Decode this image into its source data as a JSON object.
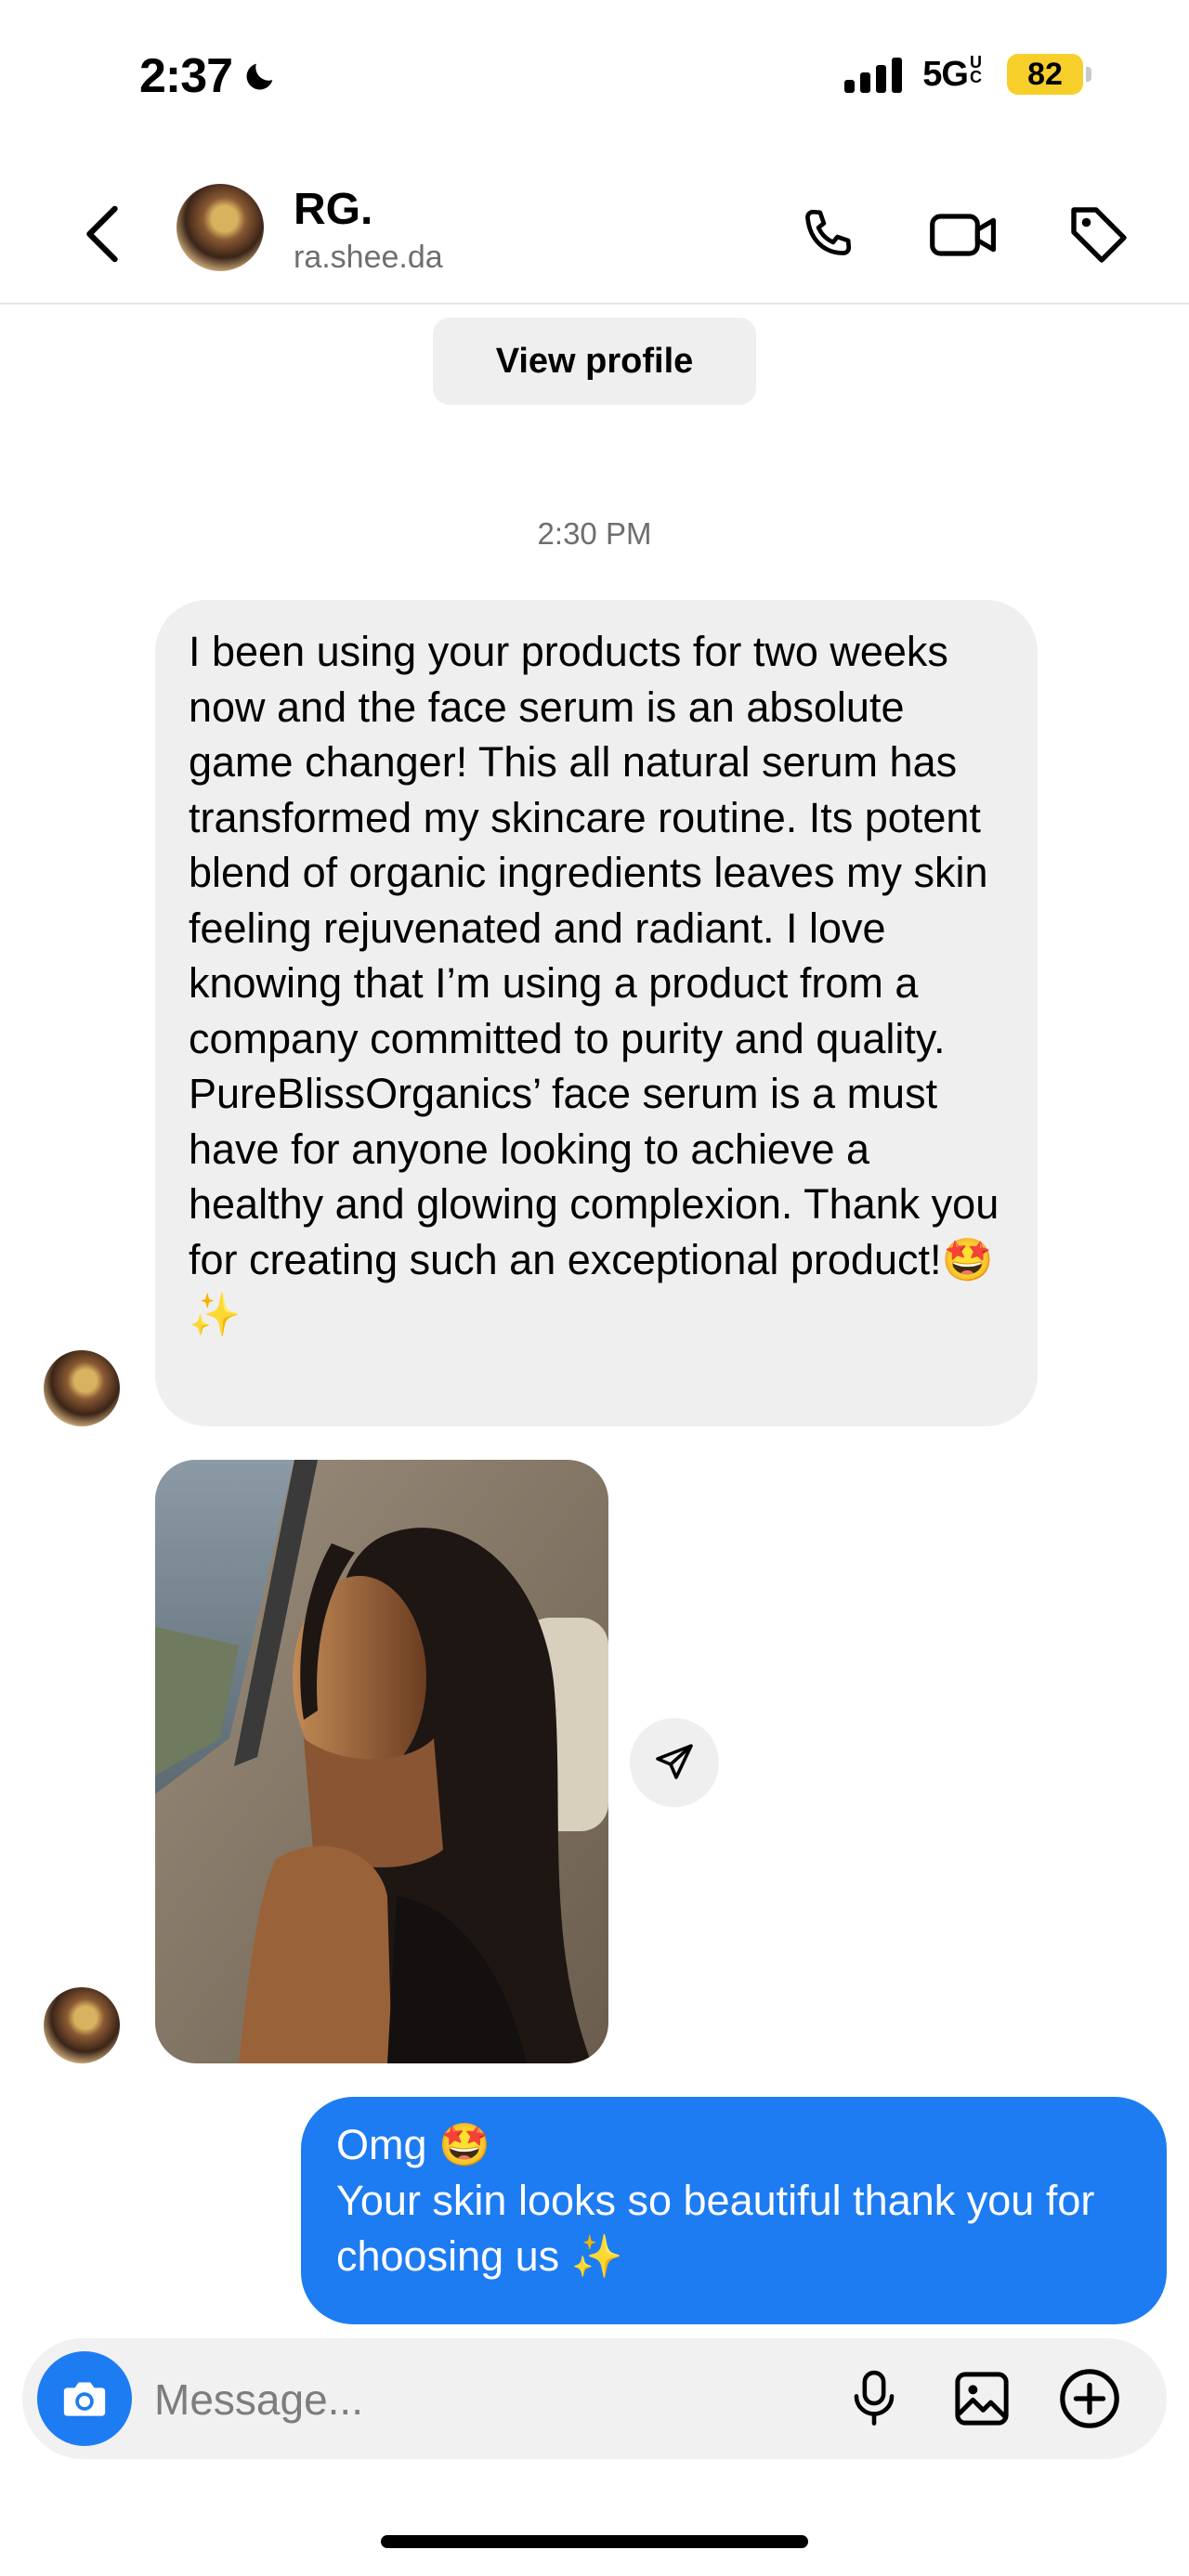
{
  "status_bar": {
    "time": "2:37",
    "network": "5G",
    "network_suffix": "UC",
    "battery": "82",
    "icons": [
      "moon-icon",
      "signal-icon",
      "battery-icon"
    ]
  },
  "header": {
    "name": "RG.",
    "handle": "ra.shee.da",
    "icons": [
      "back-arrow-icon",
      "phone-icon",
      "video-icon",
      "tag-icon"
    ]
  },
  "view_profile_label": "View profile",
  "timestamp": "2:30 PM",
  "messages": [
    {
      "direction": "incoming",
      "text": "I been using your products for two weeks now and the face serum is an absolute game changer! This all natural serum has transformed my skincare routine. Its potent blend of organic ingredients leaves my skin feeling rejuvenated and radiant. I love knowing that I’m using a product from a company committed to purity and quality. PureBlissOrganics’ face serum is a must have for anyone looking to achieve a healthy and glowing complexion. Thank you for creating such an exceptional product!🤩 ✨"
    },
    {
      "direction": "incoming",
      "type": "photo"
    },
    {
      "direction": "outgoing",
      "line1": "Omg 🤩",
      "line2": "Your skin looks so beautiful thank you for choosing us ✨"
    }
  ],
  "composer": {
    "placeholder": "Message...",
    "icons": [
      "camera-icon",
      "microphone-icon",
      "gallery-icon",
      "plus-icon"
    ]
  },
  "colors": {
    "accent": "#1d7cf2",
    "bubble_in": "#efefef",
    "battery": "#f7cf2b",
    "secondary_text": "#6e6e6e"
  }
}
